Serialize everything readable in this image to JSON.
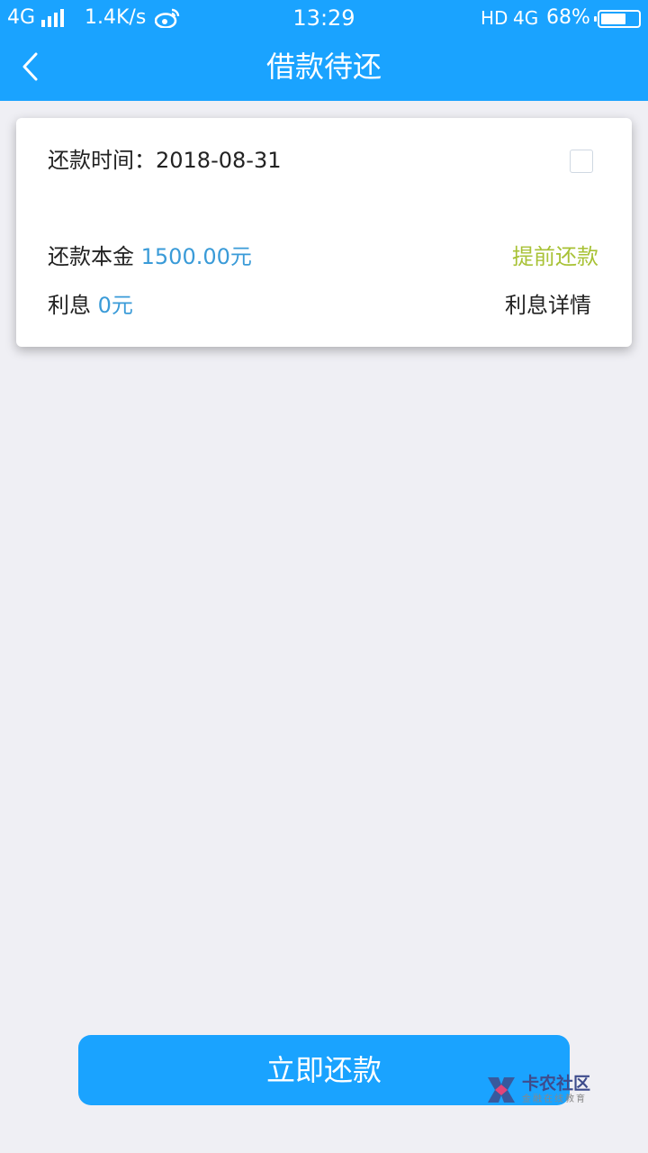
{
  "status_bar": {
    "network": "4G",
    "speed": "1.4K/s",
    "time": "13:29",
    "hd": "HD",
    "network2": "4G",
    "battery_text": "68%",
    "battery_level": 0.68,
    "icons": [
      "signal-icon",
      "weibo-icon",
      "battery-icon"
    ]
  },
  "nav": {
    "title": "借款待还",
    "back_icon": "chevron-left-icon"
  },
  "card": {
    "date_label": "还款时间：",
    "date_value": "2018-08-31",
    "principal_label": "还款本金",
    "principal_value": "1500.00元",
    "prepay_label": "提前还款",
    "interest_label": "利息",
    "interest_value": "0元",
    "interest_detail_label": "利息详情",
    "checkbox_checked": false
  },
  "pay_button": {
    "label": "立即还款"
  },
  "watermark": {
    "title": "卡农社区",
    "subtitle": "金融在线教育"
  },
  "colors": {
    "primary": "#1aa3ff",
    "value_blue": "#3a9bd8",
    "prepay_green": "#a8c236",
    "background": "#efeff4"
  }
}
